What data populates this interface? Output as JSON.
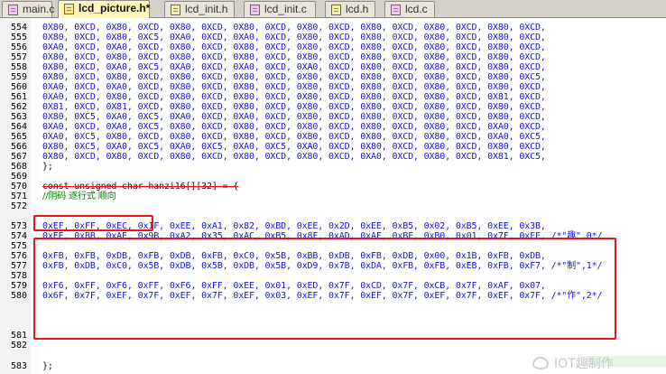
{
  "tabs": [
    {
      "label": "main.c",
      "active": false,
      "kind": "src"
    },
    {
      "label": "lcd_picture.h*",
      "active": true,
      "kind": "hdr"
    },
    {
      "label": "lcd_init.h",
      "active": false,
      "kind": "hdr"
    },
    {
      "label": "lcd_init.c",
      "active": false,
      "kind": "src"
    },
    {
      "label": "lcd.h",
      "active": false,
      "kind": "hdr"
    },
    {
      "label": "lcd.c",
      "active": false,
      "kind": "src"
    }
  ],
  "lines": [
    {
      "num": "554",
      "text": "0X80, 0XCD, 0X80, 0XCD, 0X80, 0XCD, 0X80, 0XCD, 0X80, 0XCD, 0X80, 0XCD, 0X80, 0XCD, 0X80, 0XCD,"
    },
    {
      "num": "555",
      "text": "0X80, 0XCD, 0X80, 0XC5, 0XA0, 0XCD, 0XA0, 0XCD, 0X80, 0XCD, 0X80, 0XCD, 0X80, 0XCD, 0X80, 0XCD,"
    },
    {
      "num": "556",
      "text": "0XA0, 0XCD, 0XA0, 0XCD, 0X80, 0XCD, 0X80, 0XCD, 0X80, 0XCD, 0X80, 0XCD, 0X80, 0XCD, 0X80, 0XCD,"
    },
    {
      "num": "557",
      "text": "0X80, 0XCD, 0X80, 0XCD, 0X80, 0XCD, 0X80, 0XCD, 0X80, 0XCD, 0X80, 0XCD, 0X80, 0XCD, 0X80, 0XCD,"
    },
    {
      "num": "558",
      "text": "0X80, 0XCD, 0XA0, 0XC5, 0XA0, 0XCD, 0XA0, 0XCD, 0XA0, 0XCD, 0X80, 0XCD, 0X80, 0XCD, 0X80, 0XCD,"
    },
    {
      "num": "559",
      "text": "0X80, 0XCD, 0X80, 0XCD, 0X80, 0XCD, 0X80, 0XCD, 0X80, 0XCD, 0X80, 0XCD, 0X80, 0XCD, 0X80, 0XC5,"
    },
    {
      "num": "560",
      "text": "0XA0, 0XCD, 0XA0, 0XCD, 0X80, 0XCD, 0X80, 0XCD, 0X80, 0XCD, 0X80, 0XCD, 0X80, 0XCD, 0X80, 0XCD,"
    },
    {
      "num": "561",
      "text": "0XA0, 0XCD, 0X80, 0XCD, 0X80, 0XCD, 0X80, 0XCD, 0X80, 0XCD, 0X80, 0XCD, 0X80, 0XCD, 0X81, 0XCD,"
    },
    {
      "num": "562",
      "text": "0X81, 0XCD, 0X81, 0XCD, 0X80, 0XCD, 0X80, 0XCD, 0X80, 0XCD, 0X80, 0XCD, 0X80, 0XCD, 0X80, 0XCD,"
    },
    {
      "num": "563",
      "text": "0X80, 0XC5, 0XA0, 0XC5, 0XA0, 0XCD, 0XA0, 0XCD, 0X80, 0XCD, 0X80, 0XCD, 0X80, 0XCD, 0X80, 0XCD,"
    },
    {
      "num": "564",
      "text": "0XA0, 0XCD, 0XA0, 0XC5, 0X80, 0XCD, 0X80, 0XCD, 0X80, 0XCD, 0X80, 0XCD, 0X80, 0XCD, 0XA0, 0XCD,"
    },
    {
      "num": "565",
      "text": "0XA0, 0XC5, 0X80, 0XCD, 0X80, 0XCD, 0X80, 0XCD, 0X80, 0XCD, 0X80, 0XCD, 0X80, 0XCD, 0XA0, 0XC5,"
    },
    {
      "num": "566",
      "text": "0X80, 0XC5, 0XA0, 0XC5, 0XA0, 0XC5, 0XA0, 0XC5, 0XA0, 0XCD, 0X80, 0XCD, 0X80, 0XCD, 0X80, 0XCD,"
    },
    {
      "num": "567",
      "text": "0X80, 0XCD, 0X80, 0XCD, 0X80, 0XCD, 0X80, 0XCD, 0X80, 0XCD, 0XA0, 0XCD, 0X80, 0XCD, 0X81, 0XC5,"
    },
    {
      "num": "568",
      "text": "};"
    },
    {
      "num": "569",
      "text": ""
    },
    {
      "num": "570",
      "text": "const unsigned char hanzi16[][32] = {"
    },
    {
      "num": "571",
      "text": "//阴码 逐行式 顺向"
    },
    {
      "num": "572",
      "text": ""
    },
    {
      "num": "573",
      "text": "0xEF, 0xFF, 0xEC, 0x1F, 0xEE, 0xA1, 0x82, 0xBD, 0xEE, 0x2D, 0xEE, 0xB5, 0x02, 0xB5, 0xEE, 0x3B,"
    },
    {
      "num": "574",
      "text": "0xEE, 0xBB, 0xAE, 0x9B, 0xA2, 0x35, 0xAC, 0xB5, 0x8F, 0xAD, 0xAF, 0xBF, 0xB0, 0x01, 0x7F, 0xFF, /*\"趣\",0*/"
    },
    {
      "num": "575",
      "text": ""
    },
    {
      "num": "576",
      "text": "0xFB, 0xFB, 0xDB, 0xFB, 0xDB, 0xFB, 0xC0, 0x5B, 0xBB, 0xDB, 0xFB, 0xDB, 0x00, 0x1B, 0xFB, 0xDB,"
    },
    {
      "num": "577",
      "text": "0xFB, 0xDB, 0xC0, 0x5B, 0xDB, 0x5B, 0xDB, 0x5B, 0xD9, 0x7B, 0xDA, 0xFB, 0xFB, 0xEB, 0xFB, 0xF7, /*\"制\",1*/"
    },
    {
      "num": "578",
      "text": ""
    },
    {
      "num": "579",
      "text": "0xF6, 0xFF, 0xF6, 0xFF, 0xF6, 0xFF, 0xEE, 0x01, 0xED, 0x7F, 0xCD, 0x7F, 0xCB, 0x7F, 0xAF, 0x07,"
    },
    {
      "num": "580",
      "text": "0x6F, 0x7F, 0xEF, 0x7F, 0xEF, 0x7F, 0xEF, 0x03, 0xEF, 0x7F, 0xEF, 0x7F, 0xEF, 0x7F, 0xEF, 0x7F, /*\"作\",2*/"
    },
    {
      "num": "581",
      "text": ""
    },
    {
      "num": "582",
      "text": ""
    },
    {
      "num": "583",
      "text": "};"
    }
  ],
  "watermark": "IOT趣制作"
}
